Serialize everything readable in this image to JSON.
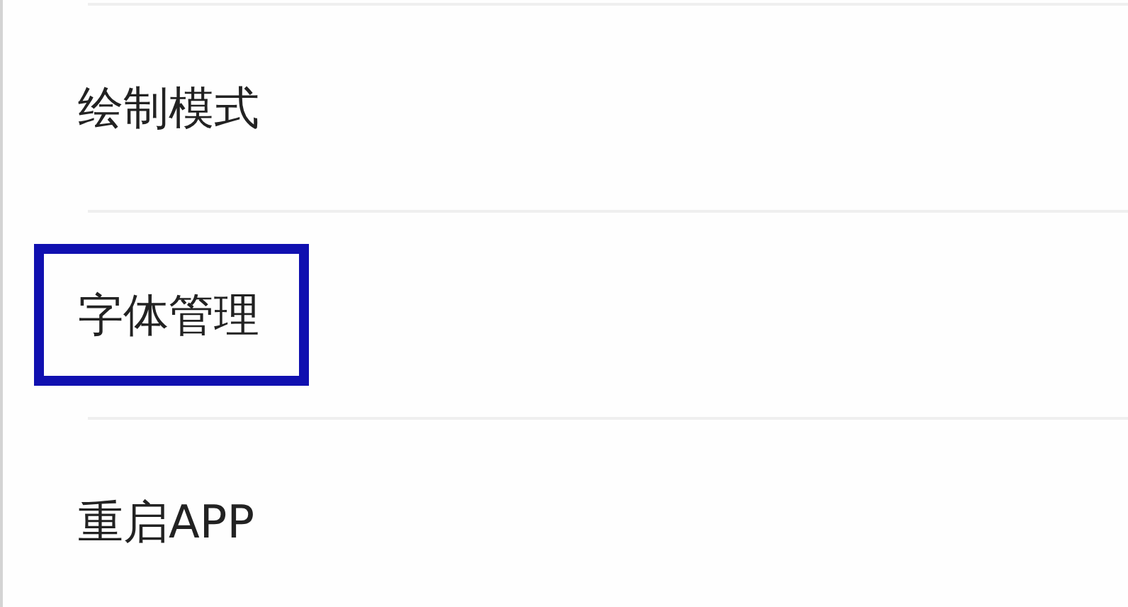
{
  "settings_items": [
    {
      "label": "绘制模式",
      "highlighted": false
    },
    {
      "label": "字体管理",
      "highlighted": true
    },
    {
      "label": "重启APP",
      "highlighted": false
    }
  ]
}
